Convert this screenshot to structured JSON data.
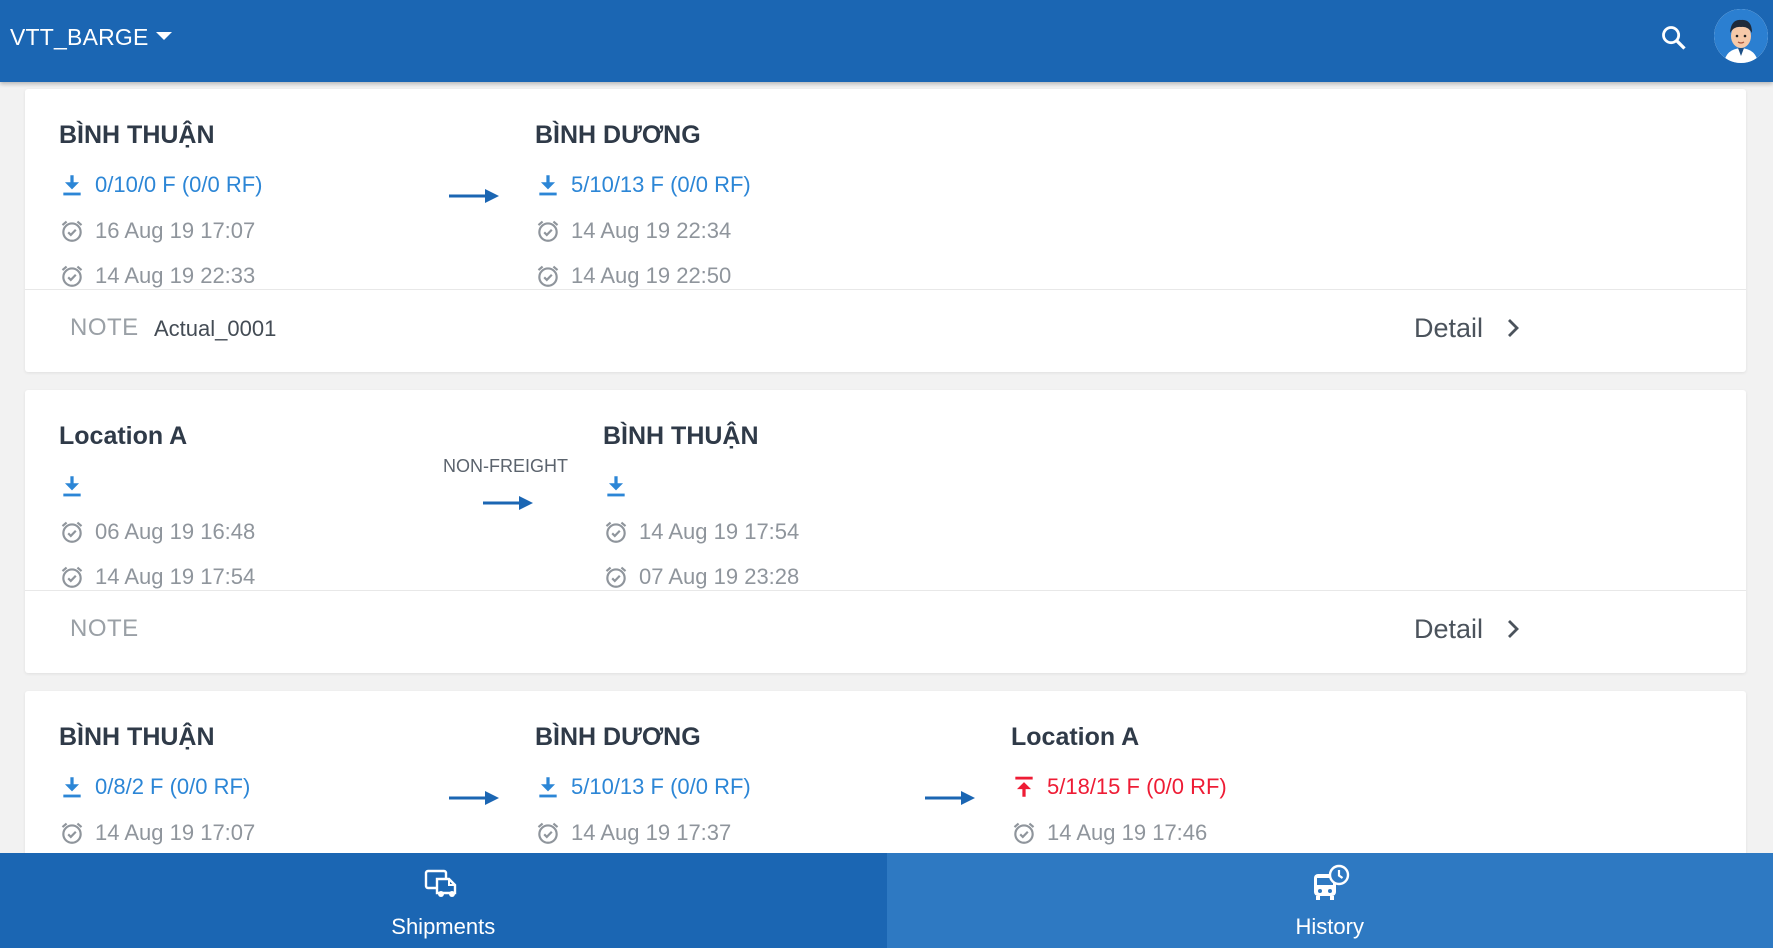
{
  "header": {
    "title": "VTT_BARGE"
  },
  "cards": [
    {
      "stops": [
        {
          "name": "BÌNH THUẬN",
          "qty": "0/10/0 F (0/0 RF)",
          "time1": "16 Aug 19 17:07",
          "time2": "14 Aug 19 22:33"
        },
        {
          "name": "BÌNH DƯƠNG",
          "qty": "5/10/13 F (0/0 RF)",
          "time1": "14 Aug 19 22:34",
          "time2": "14 Aug 19 22:50"
        }
      ],
      "note_label": "NOTE",
      "note_value": "Actual_0001",
      "detail_label": "Detail"
    },
    {
      "stops": [
        {
          "name": "Location A",
          "qty": "",
          "time1": "06 Aug 19 16:48",
          "time2": "14 Aug 19 17:54"
        },
        {
          "name": "BÌNH THUẬN",
          "qty": "",
          "time1": "14 Aug 19 17:54",
          "time2": "07 Aug 19 23:28"
        }
      ],
      "connector_label": "NON-FREIGHT",
      "note_label": "NOTE",
      "note_value": "",
      "detail_label": "Detail"
    },
    {
      "stops": [
        {
          "name": "BÌNH THUẬN",
          "qty": "0/8/2 F (0/0 RF)",
          "time1": "14 Aug 19 17:07"
        },
        {
          "name": "BÌNH DƯƠNG",
          "qty": "5/10/13 F (0/0 RF)",
          "time1": "14 Aug 19 17:37"
        },
        {
          "name": "Location A",
          "qty": "5/18/15 F (0/0 RF)",
          "qty_direction": "upload",
          "time1": "14 Aug 19 17:46"
        }
      ]
    }
  ],
  "bottom_nav": {
    "tabs": [
      {
        "label": "Shipments",
        "icon": "truck-icon",
        "active": true
      },
      {
        "label": "History",
        "icon": "bus-clock-icon",
        "active": false
      }
    ]
  },
  "colors": {
    "primary": "#1b66b3",
    "nav_inactive": "#2e79c2",
    "quantity_blue": "#2c86d6",
    "quantity_red": "#ee1c35",
    "muted_text": "#8f959c"
  }
}
